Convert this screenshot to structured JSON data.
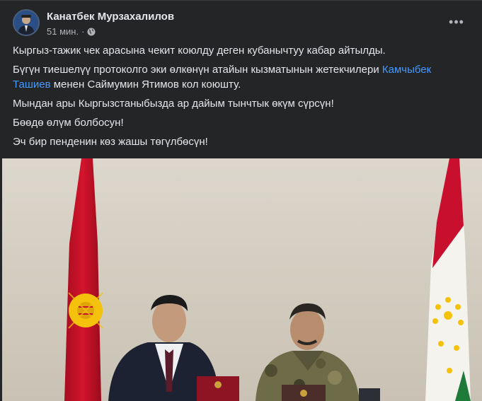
{
  "post": {
    "author": "Канатбек Мурзахалилов",
    "time": "51 мин.",
    "separator": "·",
    "more_icon": "more-horizontal-icon",
    "privacy_icon": "globe-icon",
    "paragraphs": {
      "p1": "Кыргыз-тажик чек арасына чекит коюлду деген кубанычтуу кабар айтылды.",
      "p2_before": "Бүгүн тиешелүү протоколго эки өлкөнүн атайын кызматынын жетекчилери ",
      "p2_link": "Камчыбек Ташиев",
      "p2_after": " менен Саймумин Ятимов кол коюшту.",
      "p3": "Мындан ары Кыргызстаныбызда ар дайым тынчтык өкүм сүрсүн!",
      "p4": "Бөөдө өлүм болбосун!",
      "p5": "Эч бир пенденин көз жашы төгүлбөсүн!"
    }
  },
  "colors": {
    "background": "#242526",
    "text": "#e4e6eb",
    "secondary_text": "#b0b3b8",
    "link": "#4599ff",
    "flag_red": "#c8102e",
    "flag_yellow": "#f4c20d",
    "tajik_green": "#1f7a3a"
  }
}
